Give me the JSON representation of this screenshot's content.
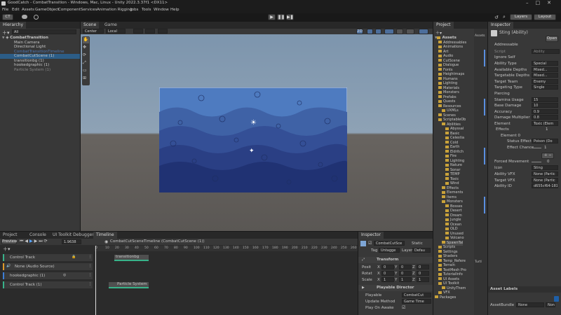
{
  "menubar": {
    "app_name": "GoodCatch",
    "window_title": "GoodCatch - CombatTransition - Windows, Mac, Linux - Unity 2022.3.37f1 <DX11>",
    "items": [
      "File",
      "Edit",
      "Assets",
      "GameObject",
      "Component",
      "Services",
      "Animation Rigging",
      "Jobs",
      "Tools",
      "Window",
      "Help"
    ]
  },
  "toolbar": {
    "account": "CT",
    "layers": "Layers",
    "layout": "Layout"
  },
  "hierarchy": {
    "tab": "Hierarchy",
    "search_placeholder": "All",
    "scene": "CombatTransition",
    "items": [
      "Main Camera",
      "Directional Light",
      "CombatTransitionTimeline",
      "CombatCutScene (1)",
      "transitionbg (1)",
      "hookedgraphic (1)",
      "Particle System (1)"
    ]
  },
  "scene": {
    "tabs": [
      "Scene",
      "Game"
    ],
    "pivot": "Center",
    "space": "Local",
    "persp": "2D"
  },
  "project_bottom": {
    "tabs": [
      "Project",
      "Console",
      "UI Toolkit Debugger",
      "Timeline"
    ]
  },
  "timeline": {
    "mode": "Preview",
    "frame": "1.9638",
    "asset": "CombatCutSceneTimeline (CombatCutScene (1))",
    "ruler": [
      "0",
      "10",
      "20",
      "30",
      "40",
      "50",
      "60",
      "70",
      "80",
      "90",
      "100",
      "110",
      "120",
      "130",
      "140",
      "150",
      "160",
      "170",
      "180",
      "190",
      "200",
      "210",
      "220",
      "230",
      "240",
      "250",
      "260"
    ],
    "tracks": [
      {
        "name": "Control Track",
        "clip": "transitionbg"
      },
      {
        "name": "None (Audio Source)",
        "clip": ""
      },
      {
        "name": "hookedgraphic (1)",
        "clip": ""
      },
      {
        "name": "Control Track (1)",
        "clip": "Particle System"
      }
    ]
  },
  "inspector_small": {
    "tab": "Inspector",
    "name": "CombatCutSce",
    "static": "Static",
    "tag_label": "Tag",
    "tag": "Untagge",
    "layer_label": "Layer",
    "layer": "Defau",
    "transform": "Transform",
    "pos_label": "Posit",
    "rot_label": "Rotat",
    "scale_label": "Scale",
    "pos": [
      "0",
      "0",
      "0"
    ],
    "rot": [
      "0",
      "0",
      "0"
    ],
    "scale": [
      "1",
      "1",
      "1"
    ],
    "director": "Playable Director",
    "playable_label": "Playable",
    "playable": "CombatCut",
    "update_label": "Update Method",
    "update": "Game Time",
    "awake_label": "Play On Awake"
  },
  "project": {
    "tab": "Project",
    "root": "Assets",
    "items": [
      "Addressables",
      "Animations",
      "Art",
      "Audio",
      "CutScene",
      "Dialogue",
      "Fonts",
      "Heightmaps",
      "Humans",
      "Lighting",
      "Materials",
      "Monsters",
      "Prefabs",
      "Quests",
      "Resources",
      "UXMLs",
      "Scenes",
      "ScriptableOb",
      "Abilities",
      "Abyssal",
      "Basic",
      "Celestia",
      "Cold",
      "Earth",
      "Eldritch",
      "Fire",
      "Lighting",
      "Nature",
      "Sonar",
      "TEMP",
      "Toxic",
      "Wind",
      "Effects",
      "Elements",
      "Items",
      "Monsters",
      "Bosses",
      "Desert",
      "Dream",
      "Jungle",
      "Ocean",
      "OLD",
      "Unused",
      "Volcano",
      "SpawnTal",
      "Scripts",
      "Settings",
      "Shaders",
      "Temp_Refere",
      "Terrain",
      "TextMesh Pro",
      "TutorialInfo",
      "UI Assets",
      "UI Toolkit",
      "UnityThem",
      "VFX",
      "Packages"
    ],
    "side_label": "Assets",
    "turtle": "Turtl"
  },
  "inspector": {
    "tab": "Inspector",
    "title": "Sting (Ability)",
    "open": "Open",
    "addressable": "Addressable",
    "script_label": "Script",
    "script": "Ability",
    "ignore_label": "Ignore Self",
    "fields": [
      [
        "Ability Type",
        "Special"
      ],
      [
        "Available Depths",
        "Mixed..."
      ],
      [
        "Targetable Depths",
        "Mixed..."
      ],
      [
        "Target Team",
        "Enemy"
      ],
      [
        "Targeting Type",
        "Single"
      ],
      [
        "Piercing",
        ""
      ],
      [
        "Stamina Usage",
        "15"
      ],
      [
        "Base Damage",
        "10"
      ],
      [
        "Accuracy",
        "0.9"
      ],
      [
        "Damage Multiplier",
        "0.8"
      ],
      [
        "Element",
        "Toxic (Elem"
      ]
    ],
    "effects_label": "Effects",
    "effects_count": "1",
    "element0": "Element 0",
    "status_label": "Status Effect",
    "status": "Poison (Do",
    "chance_label": "Effect Chance",
    "chance": "1",
    "forced_label": "Forced Movement",
    "forced": "0",
    "icon_label": "Icon",
    "icon": "Sting",
    "ability_vfx_label": "Ability VFX",
    "ability_vfx": "None (Partic",
    "target_vfx_label": "Target VFX",
    "target_vfx": "None (Partic",
    "ability_id_label": "Ability ID",
    "ability_id": "d655cf64-181c-4",
    "asset_labels": "Asset Labels",
    "assetbundle_label": "AssetBundle",
    "assetbundle": "None",
    "assetbundle2": "None"
  }
}
